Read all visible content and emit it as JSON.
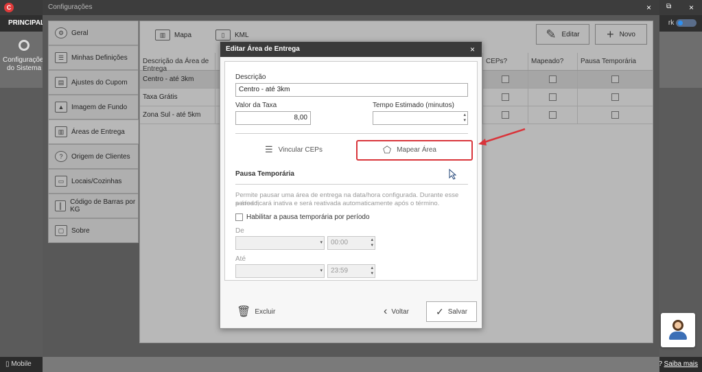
{
  "app": {
    "menu_label": "PRINCIPAL",
    "ribbon_item": "Configurações do Sistema",
    "dark_label": "rk",
    "status_mobile": "Mobile",
    "status_help_q": "?",
    "status_help": "Saiba mais"
  },
  "settings": {
    "title": "Configurações",
    "win_controls": {
      "close_bg": "×",
      "restore": "⧉",
      "close": "×"
    },
    "sidebar": [
      {
        "label": "Geral",
        "icon": "gear-icon"
      },
      {
        "label": "Minhas Definições",
        "icon": "list-icon"
      },
      {
        "label": "Ajustes do Cupom",
        "icon": "receipt-icon"
      },
      {
        "label": "Imagem de Fundo",
        "icon": "image-icon"
      },
      {
        "label": "Áreas de Entrega",
        "icon": "map-icon"
      },
      {
        "label": "Origem de Clientes",
        "icon": "question-icon"
      },
      {
        "label": "Locais/Cozinhas",
        "icon": "kitchen-icon"
      },
      {
        "label": "Código de Barras por KG",
        "icon": "barcode-icon"
      },
      {
        "label": "Sobre",
        "icon": "monitor-icon"
      }
    ],
    "tabs": {
      "map": "Mapa",
      "kml": "KML"
    },
    "buttons": {
      "edit": "Editar",
      "new": "Novo"
    },
    "table": {
      "headers": [
        "Descrição da Área de Entrega",
        "",
        "CEPs?",
        "Mapeado?",
        "Pausa Temporária"
      ],
      "rows": [
        {
          "desc": "Centro - até 3km"
        },
        {
          "desc": "Taxa Grátis"
        },
        {
          "desc": "Zona Sul - até 5km"
        }
      ]
    }
  },
  "modal": {
    "title": "Editar Área de Entrega",
    "close": "×",
    "descricao_label": "Descrição",
    "descricao_value": "Centro - até 3km",
    "taxa_label": "Valor da Taxa",
    "taxa_value": "8,00",
    "tempo_label": "Tempo Estimado (minutos)",
    "tempo_value": "",
    "vincular_ceps": "Vincular CEPs",
    "mapear_area": "Mapear Área",
    "pausa_title": "Pausa Temporária",
    "pausa_desc_1": "Permite pausar uma área de entrega na data/hora configurada. Durante esse período,",
    "pausa_desc_2": "a área ficará inativa e será reativada automaticamente após o término.",
    "pausa_checkbox": "Habilitar a pausa temporária por período",
    "de_label": "De",
    "de_time": "00:00",
    "ate_label": "Até",
    "ate_time": "23:59",
    "excluir": "Excluir",
    "voltar": "Voltar",
    "salvar": "Salvar"
  },
  "colors": {
    "highlight": "#d9343a",
    "title_bar": "#3a3a3a"
  }
}
